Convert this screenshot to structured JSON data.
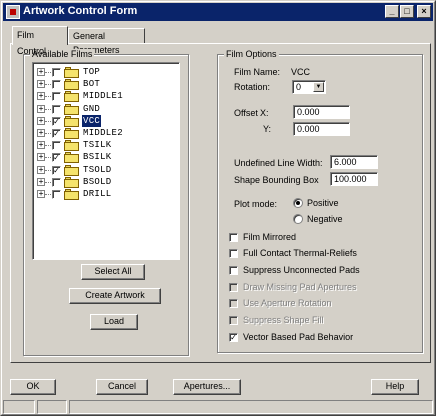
{
  "window": {
    "title": "Artwork Control Form",
    "controls": {
      "minimize": "_",
      "maximize": "□",
      "close": "×"
    }
  },
  "tabs": [
    {
      "label": "Film Control",
      "active": true
    },
    {
      "label": "General Parameters",
      "active": false
    }
  ],
  "available_films": {
    "label": "Available Films",
    "items": [
      {
        "name": "TOP",
        "checked": false,
        "selected": false
      },
      {
        "name": "BOT",
        "checked": false,
        "selected": false
      },
      {
        "name": "MIDDLE1",
        "checked": false,
        "selected": false
      },
      {
        "name": "GND",
        "checked": false,
        "selected": false
      },
      {
        "name": "VCC",
        "checked": true,
        "selected": true
      },
      {
        "name": "MIDDLE2",
        "checked": true,
        "selected": false
      },
      {
        "name": "TSILK",
        "checked": false,
        "selected": false
      },
      {
        "name": "BSILK",
        "checked": true,
        "selected": false
      },
      {
        "name": "TSOLD",
        "checked": true,
        "selected": false
      },
      {
        "name": "BSOLD",
        "checked": false,
        "selected": false
      },
      {
        "name": "DRILL",
        "checked": false,
        "selected": false
      }
    ],
    "expander_glyph": "+",
    "check_glyph": "✓"
  },
  "left_buttons": {
    "select_all": "Select All",
    "create_artwork": "Create Artwork",
    "load": "Load"
  },
  "film_options": {
    "label": "Film Options",
    "film_name_label": "Film Name:",
    "film_name_value": "VCC",
    "rotation_label": "Rotation:",
    "rotation_value": "0",
    "offset_label": "Offset",
    "offset_x_label": "X:",
    "offset_x_value": "0.000",
    "offset_y_label": "Y:",
    "offset_y_value": "0.000",
    "undefined_line_width_label": "Undefined Line Width:",
    "undefined_line_width_value": "6.000",
    "shape_bounding_box_label": "Shape Bounding Box",
    "shape_bounding_box_value": "100.000",
    "plot_mode_label": "Plot mode:",
    "plot_mode_positive": "Positive",
    "plot_mode_negative": "Negative",
    "plot_mode_selected": "Positive",
    "options": [
      {
        "label": "Film Mirrored",
        "checked": false,
        "enabled": true
      },
      {
        "label": "Full Contact Thermal-Reliefs",
        "checked": false,
        "enabled": true
      },
      {
        "label": "Suppress Unconnected Pads",
        "checked": false,
        "enabled": true
      },
      {
        "label": "Draw Missing Pad Apertures",
        "checked": false,
        "enabled": false
      },
      {
        "label": "Use Aperture Rotation",
        "checked": false,
        "enabled": false
      },
      {
        "label": "Suppress Shape Fill",
        "checked": false,
        "enabled": false
      },
      {
        "label": "Vector Based Pad Behavior",
        "checked": true,
        "enabled": true
      }
    ]
  },
  "footer": {
    "ok": "OK",
    "cancel": "Cancel",
    "apertures": "Apertures...",
    "help": "Help"
  }
}
